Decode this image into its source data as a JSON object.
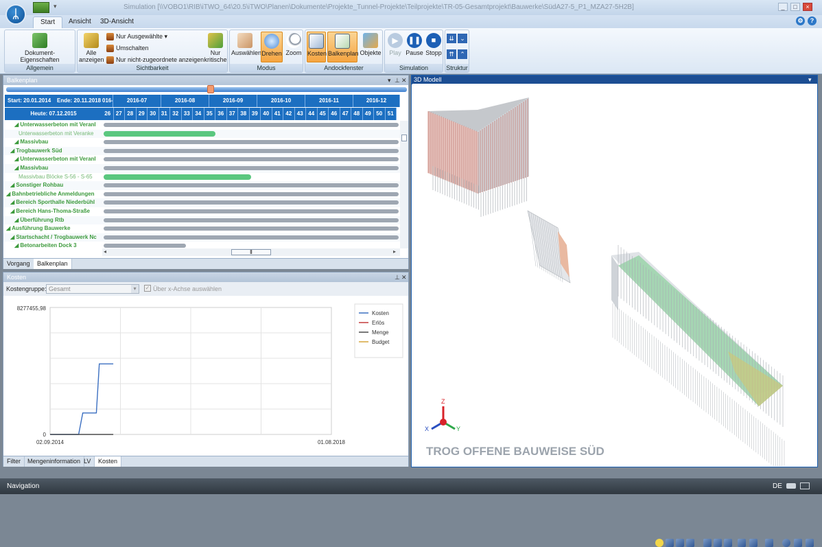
{
  "window": {
    "title": "Simulation [\\\\VOBO1\\RIB\\iTWO_64\\20.5\\iTWO\\Planen\\Dokumente\\Projekte_Tunnel-Projekte\\Teilprojekte\\TR-05-Gesamtprojekt\\Bauwerke\\SüdA27-5_P1_MZA27-5H2B]"
  },
  "tabs": [
    "Start",
    "Ansicht",
    "3D-Ansicht"
  ],
  "ribbon": {
    "allgemein": {
      "label": "Allgemein",
      "btn": "Dokument-Eigenschaften"
    },
    "sichtbarkeit": {
      "label": "Sichtbarkeit",
      "alle": "Alle anzeigen",
      "nur_ausgewaehlte": "Nur Ausgewählte",
      "umschalten": "Umschalten",
      "nicht_zugeordnete": "Nur nicht-zugeordnete anzeigen",
      "nur_kritische": "Nur kritische"
    },
    "modus": {
      "label": "Modus",
      "auswaehlen": "Auswählen",
      "drehen": "Drehen",
      "zoom": "Zoom"
    },
    "andock": {
      "label": "Andockfenster",
      "kosten": "Kosten",
      "balkenplan": "Balkenplan",
      "objekte": "Objekte"
    },
    "simulation": {
      "label": "Simulation",
      "play": "Play",
      "pause": "Pause",
      "stopp": "Stopp"
    },
    "struktur": {
      "label": "Struktur"
    }
  },
  "balkenplan": {
    "title": "Balkenplan",
    "start": "Start: 20.01.2014",
    "ende": "Ende: 20.11.2018",
    "heute": "Heute: 07.12.2015",
    "months": [
      "016-0",
      "2016-07",
      "2016-08",
      "2016-09",
      "2016-10",
      "2016-11",
      "2016-12"
    ],
    "weeks": [
      "26",
      "27",
      "28",
      "29",
      "30",
      "31",
      "32",
      "33",
      "34",
      "35",
      "36",
      "37",
      "38",
      "39",
      "40",
      "41",
      "42",
      "43",
      "44",
      "45",
      "46",
      "47",
      "48",
      "49",
      "50",
      "51"
    ],
    "rows": [
      {
        "label": "Unterwasserbeton mit Veranl",
        "light": false,
        "indent": 2,
        "bar": "grey",
        "s": 0.0,
        "e": 1.0
      },
      {
        "label": "Unterwasserbeton mit Veranke",
        "light": true,
        "indent": 3,
        "bar": "green",
        "s": 0.0,
        "e": 0.38
      },
      {
        "label": "Massivbau",
        "light": false,
        "indent": 2,
        "bar": "grey",
        "s": 0.0,
        "e": 1.0
      },
      {
        "label": "Trogbauwerk Süd",
        "light": false,
        "indent": 1,
        "bar": "grey",
        "s": 0.0,
        "e": 1.0
      },
      {
        "label": "Unterwasserbeton mit Veranl",
        "light": false,
        "indent": 2,
        "bar": "grey",
        "s": 0.0,
        "e": 1.0
      },
      {
        "label": "Massivbau",
        "light": false,
        "indent": 2,
        "bar": "grey",
        "s": 0.0,
        "e": 1.0
      },
      {
        "label": "Massivbau Blöcke S-56 - S-65",
        "light": true,
        "indent": 3,
        "bar": "green",
        "s": 0.0,
        "e": 0.5
      },
      {
        "label": "Sonstiger Rohbau",
        "light": false,
        "indent": 1,
        "bar": "grey",
        "s": 0.0,
        "e": 1.0
      },
      {
        "label": "Bahnbetriebliche Anmeldungen",
        "light": false,
        "indent": 0,
        "bar": "grey",
        "s": 0.0,
        "e": 1.0
      },
      {
        "label": "Bereich Sporthalle Niederbühl",
        "light": false,
        "indent": 1,
        "bar": "grey",
        "s": 0.0,
        "e": 1.0
      },
      {
        "label": "Bereich Hans-Thoma-Straße",
        "light": false,
        "indent": 1,
        "bar": "grey",
        "s": 0.0,
        "e": 1.0
      },
      {
        "label": "Überführung Rtb",
        "light": false,
        "indent": 2,
        "bar": "grey",
        "s": 0.0,
        "e": 1.0
      },
      {
        "label": "Ausführung Bauwerke",
        "light": false,
        "indent": 0,
        "bar": "grey",
        "s": 0.0,
        "e": 1.0
      },
      {
        "label": "Startschacht / Trogbauwerk Nc",
        "light": false,
        "indent": 1,
        "bar": "grey",
        "s": 0.0,
        "e": 1.0
      },
      {
        "label": "Betonarbeiten Dock 3",
        "light": false,
        "indent": 2,
        "bar": "grey",
        "s": 0.0,
        "e": 0.28
      }
    ],
    "tabs": [
      "Vorgang",
      "Balkenplan"
    ],
    "timeline_position": 0.51
  },
  "kosten": {
    "title": "Kosten",
    "gruppe_label": "Kostengruppe:",
    "gruppe_value": "Gesamt",
    "achse_label": "Über x-Achse auswählen",
    "tabs": [
      "Filter",
      "Mengeninformation",
      "LV",
      "Kosten"
    ]
  },
  "chart_data": {
    "type": "line",
    "title": "",
    "xlabel": "",
    "ylabel": "",
    "x_ticks": [
      "02.09.2014",
      "01.08.2018"
    ],
    "y_ticks": [
      "8277455,98",
      "0"
    ],
    "ylim": [
      0,
      8277455.98
    ],
    "grid": true,
    "legend_position": "top-right",
    "series": [
      {
        "name": "Kosten",
        "color": "#3b6fc1",
        "x": [
          "02.09.2014",
          "2015-01-25",
          "2015-02-15",
          "2015-04-25",
          "2015-05-10",
          "2015-07-20"
        ],
        "y": [
          0,
          0,
          1400000,
          1400000,
          4600000,
          4600000
        ]
      },
      {
        "name": "Erlös",
        "color": "#c23b3b",
        "x": [],
        "y": []
      },
      {
        "name": "Menge",
        "color": "#4a4a4a",
        "x": [
          "02.09.2014",
          "2015-07-20"
        ],
        "y": [
          0,
          0
        ]
      },
      {
        "name": "Budget",
        "color": "#d6a63a",
        "x": [],
        "y": []
      }
    ]
  },
  "modell": {
    "title": "3D Modell",
    "label": "TROG OFFENE BAUWEISE SÜD",
    "axes": [
      "Z",
      "X",
      "Y"
    ]
  },
  "status": {
    "left": "Navigation",
    "lang": "DE"
  },
  "colors": {
    "accent": "#1c6fc1",
    "green": "#5ac77f"
  }
}
